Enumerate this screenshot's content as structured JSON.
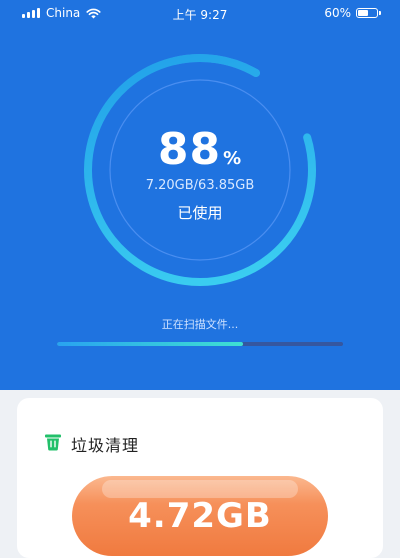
{
  "status_bar": {
    "carrier": "China",
    "time": "上午 9:27",
    "battery_text": "60%",
    "battery_level": 0.6
  },
  "gauge": {
    "percent_value": "88",
    "percent_sign": "%",
    "used_text": "7.20GB/63.85GB",
    "label": "已使用",
    "fill_fraction": 0.88,
    "colors": {
      "track": "#3b8df0",
      "arc_start": "#3fd5f2",
      "arc_end": "#1f9ce8",
      "inner_ring": "#4a8ef0"
    }
  },
  "scan": {
    "label": "正在扫描文件...",
    "progress": 0.65
  },
  "junk_card": {
    "title": "垃圾清理",
    "size": "4.72GB",
    "icon": "trash-icon"
  },
  "colors": {
    "primary_blue": "#1f73e0",
    "accent_green": "#22c06a",
    "accent_orange": "#f07a3f"
  }
}
